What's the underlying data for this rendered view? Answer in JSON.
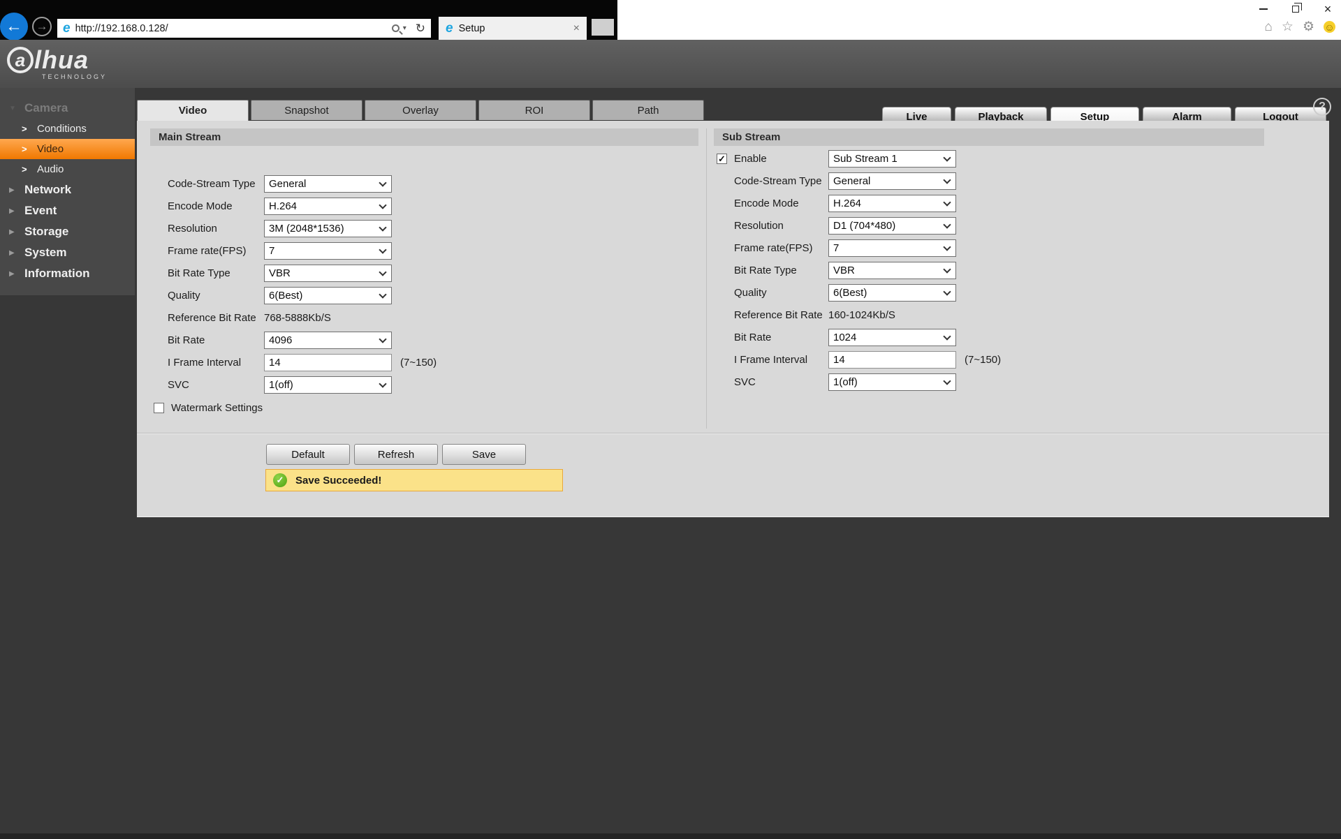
{
  "icons": {
    "back": "←",
    "forward": "→",
    "ie": "e",
    "caret": "▾",
    "refresh": "↻",
    "close": "×",
    "home": "⌂",
    "star": "☆",
    "gear": "⚙",
    "smiley": "☺",
    "tri_down": "▼",
    "tri_right": "▶",
    "chevron": ">",
    "help": "?",
    "check": "✓"
  },
  "browser": {
    "url": "http://192.168.0.128/",
    "tab_title": "Setup"
  },
  "brand": {
    "a": "a",
    "rest": "lhua",
    "tagline": "TECHNOLOGY"
  },
  "nav": [
    {
      "label": "Live"
    },
    {
      "label": "Playback"
    },
    {
      "label": "Setup"
    },
    {
      "label": "Alarm"
    },
    {
      "label": "Logout"
    }
  ],
  "sidebar": {
    "camera": "Camera",
    "conditions": "Conditions",
    "video": "Video",
    "audio": "Audio",
    "network": "Network",
    "event": "Event",
    "storage": "Storage",
    "system": "System",
    "information": "Information"
  },
  "tabs": [
    {
      "label": "Video"
    },
    {
      "label": "Snapshot"
    },
    {
      "label": "Overlay"
    },
    {
      "label": "ROI"
    },
    {
      "label": "Path"
    }
  ],
  "main_stream": {
    "title": "Main Stream",
    "rows": [
      {
        "label": "Code-Stream Type",
        "type": "select",
        "value": "General"
      },
      {
        "label": "Encode Mode",
        "type": "select",
        "value": "H.264"
      },
      {
        "label": "Resolution",
        "type": "select",
        "value": "3M (2048*1536)"
      },
      {
        "label": "Frame rate(FPS)",
        "type": "select",
        "value": "7"
      },
      {
        "label": "Bit Rate Type",
        "type": "select",
        "value": "VBR"
      },
      {
        "label": "Quality",
        "type": "select",
        "value": "6(Best)"
      },
      {
        "label": "Reference Bit Rate",
        "type": "static",
        "value": "768-5888Kb/S"
      },
      {
        "label": "Bit Rate",
        "type": "select",
        "value": "4096"
      },
      {
        "label": "I Frame Interval",
        "type": "input",
        "value": "14",
        "note": "(7~150)"
      },
      {
        "label": "SVC",
        "type": "select",
        "value": "1(off)"
      }
    ],
    "watermark": {
      "label": "Watermark Settings",
      "checked": false
    }
  },
  "sub_stream": {
    "title": "Sub Stream",
    "enable": {
      "label": "Enable",
      "checked": true,
      "value": "Sub Stream 1"
    },
    "rows": [
      {
        "label": "Code-Stream Type",
        "type": "select",
        "value": "General"
      },
      {
        "label": "Encode Mode",
        "type": "select",
        "value": "H.264"
      },
      {
        "label": "Resolution",
        "type": "select",
        "value": "D1 (704*480)"
      },
      {
        "label": "Frame rate(FPS)",
        "type": "select",
        "value": "7"
      },
      {
        "label": "Bit Rate Type",
        "type": "select",
        "value": "VBR"
      },
      {
        "label": "Quality",
        "type": "select",
        "value": "6(Best)"
      },
      {
        "label": "Reference Bit Rate",
        "type": "static",
        "value": "160-1024Kb/S"
      },
      {
        "label": "Bit Rate",
        "type": "select",
        "value": "1024"
      },
      {
        "label": "I Frame Interval",
        "type": "input",
        "value": "14",
        "note": "(7~150)"
      },
      {
        "label": "SVC",
        "type": "select",
        "value": "1(off)"
      }
    ]
  },
  "buttons": {
    "default": "Default",
    "refresh": "Refresh",
    "save": "Save"
  },
  "status": {
    "message": "Save Succeeded!"
  }
}
